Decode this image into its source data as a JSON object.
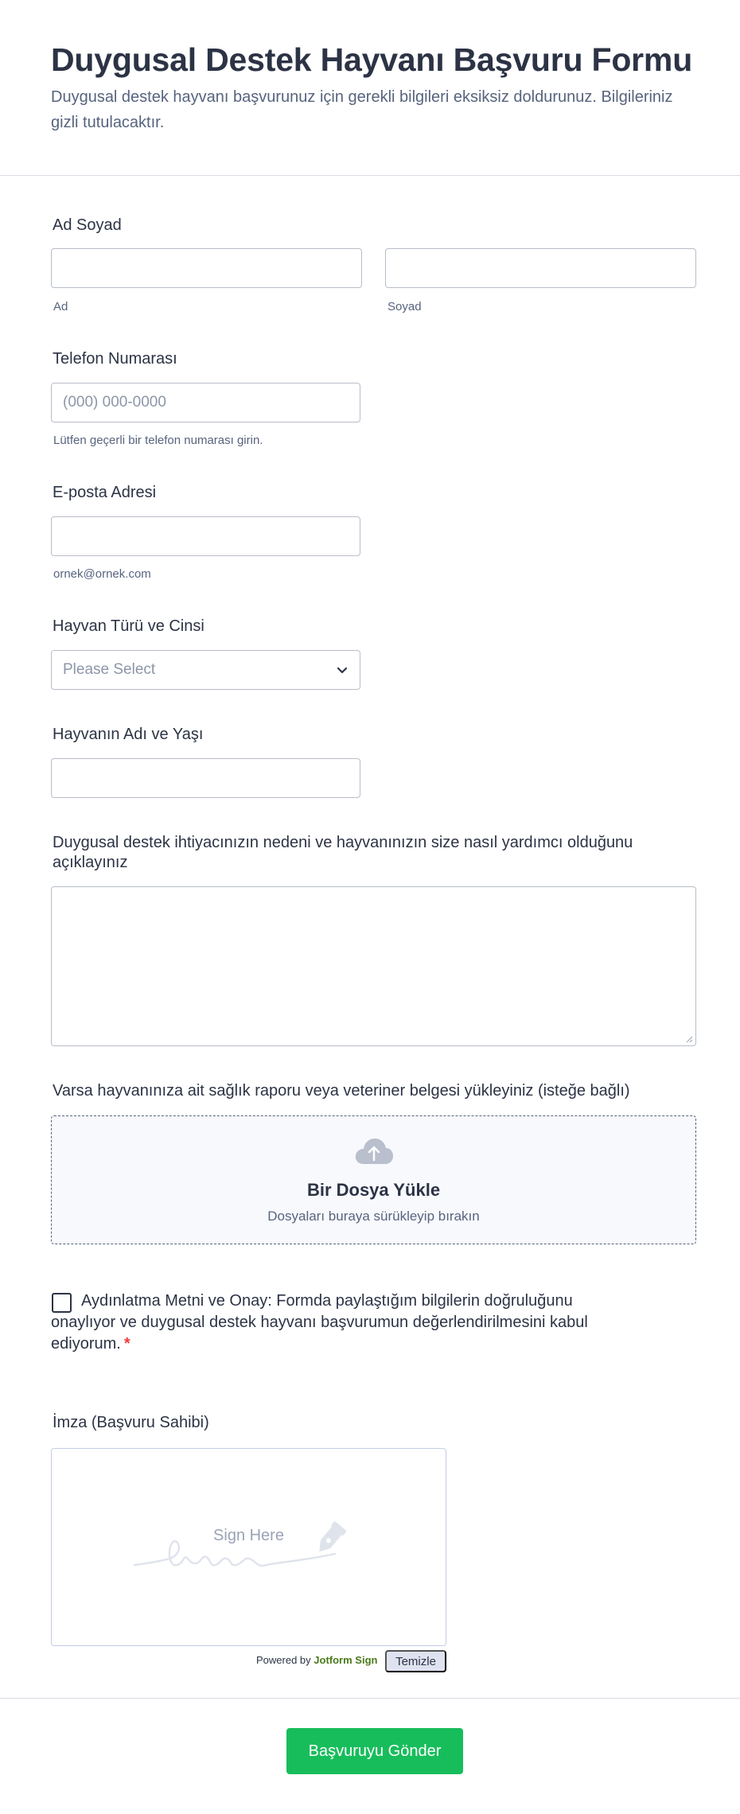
{
  "form": {
    "title": "Duygusal Destek Hayvanı Başvuru Formu",
    "description": "Duygusal destek hayvanı başvurunuz için gerekli bilgileri eksiksiz doldurunuz. Bilgileriniz gizli tutulacaktır."
  },
  "fields": {
    "name": {
      "label": "Ad Soyad",
      "first_sublabel": "Ad",
      "last_sublabel": "Soyad",
      "first_value": "",
      "last_value": ""
    },
    "phone": {
      "label": "Telefon Numarası",
      "placeholder": "(000) 000-0000",
      "sublabel": "Lütfen geçerli bir telefon numarası girin."
    },
    "email": {
      "label": "E-posta Adresi",
      "sublabel": "ornek@ornek.com"
    },
    "animal_type": {
      "label": "Hayvan Türü ve Cinsi",
      "selected": "Please Select"
    },
    "animal_name_age": {
      "label": "Hayvanın Adı ve Yaşı"
    },
    "reason": {
      "label": "Duygusal destek ihtiyacınızın nedeni ve hayvanınızın size nasıl yardımcı olduğunu açıklayınız"
    },
    "upload": {
      "label": "Varsa hayvanınıza ait sağlık raporu veya veteriner belgesi yükleyiniz (isteğe bağlı)",
      "title": "Bir Dosya Yükle",
      "subtitle": "Dosyaları buraya sürükleyip bırakın"
    },
    "consent": {
      "text": "Aydınlatma Metni ve Onay: Formda paylaştığım bilgilerin doğruluğunu onaylıyor ve duygusal destek hayvanı başvurumun değerlendirilmesini kabul ediyorum.",
      "required_mark": "*"
    },
    "signature": {
      "label": "İmza (Başvuru Sahibi)",
      "placeholder": "Sign Here",
      "powered_prefix": "Powered by",
      "powered_brand": "Jotform Sign",
      "clear_label": "Temizle"
    }
  },
  "submit_label": "Başvuruyu Gönder",
  "colors": {
    "submit": "#18bd5b",
    "text": "#2c3345",
    "muted": "#57647e",
    "required": "#f23a3c"
  },
  "icons": {
    "dropdown": "chevron-down-icon",
    "upload": "cloud-upload-icon",
    "signature": "pen-nib-icon"
  }
}
